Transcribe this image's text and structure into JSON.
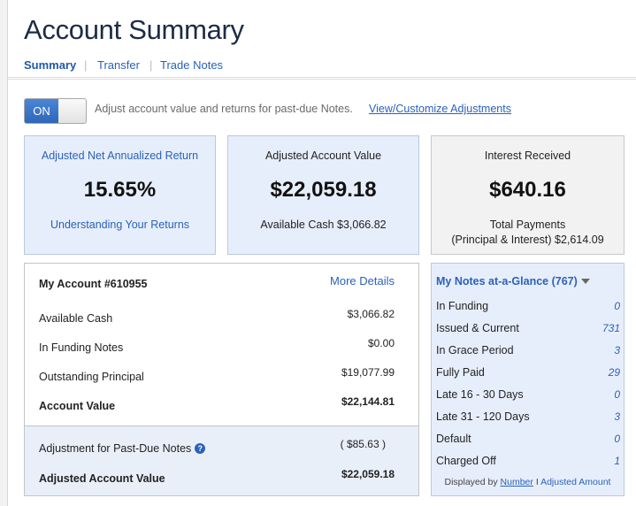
{
  "header": {
    "title": "Account Summary"
  },
  "subnav": {
    "summary": "Summary",
    "transfer": "Transfer",
    "trade_notes": "Trade Notes",
    "separator": "|"
  },
  "toggle": {
    "state_label": "ON"
  },
  "adjust": {
    "text": "Adjust account value and returns for past-due Notes.",
    "link": "View/Customize Adjustments"
  },
  "cards": {
    "return": {
      "label": "Adjusted Net Annualized Return",
      "value": "15.65%",
      "link": "Understanding Your Returns"
    },
    "value": {
      "label": "Adjusted Account Value",
      "value": "$22,059.18",
      "sub": "Available Cash $3,066.82"
    },
    "interest": {
      "label": "Interest Received",
      "value": "$640.16",
      "sub1": "Total Payments",
      "sub2": "(Principal & Interest) $2,614.09"
    }
  },
  "account": {
    "heading": "My Account #610955",
    "more": "More Details",
    "rows": [
      {
        "label": "Available Cash",
        "value": "$3,066.82"
      },
      {
        "label": "In Funding Notes",
        "value": "$0.00"
      },
      {
        "label": "Outstanding Principal",
        "value": "$19,077.99"
      },
      {
        "label": "Account Value",
        "value": "$22,144.81"
      }
    ],
    "adjustment": {
      "label": "Adjustment for Past-Due Notes",
      "value": "( $85.63 )",
      "help": "?"
    },
    "adjusted": {
      "label": "Adjusted Account Value",
      "value": "$22,059.18"
    }
  },
  "notes": {
    "heading": "My Notes at-a-Glance (767)",
    "rows": [
      {
        "label": "In Funding",
        "value": "0"
      },
      {
        "label": "Issued & Current",
        "value": "731"
      },
      {
        "label": "In Grace Period",
        "value": "3"
      },
      {
        "label": "Fully Paid",
        "value": "29"
      },
      {
        "label": "Late 16 - 30 Days",
        "value": "0"
      },
      {
        "label": "Late 31 - 120 Days",
        "value": "3"
      },
      {
        "label": "Default",
        "value": "0"
      },
      {
        "label": "Charged Off",
        "value": "1"
      }
    ],
    "footer": {
      "prefix": "Displayed by",
      "number": "Number",
      "sep": "I",
      "amount": "Adjusted Amount"
    }
  }
}
